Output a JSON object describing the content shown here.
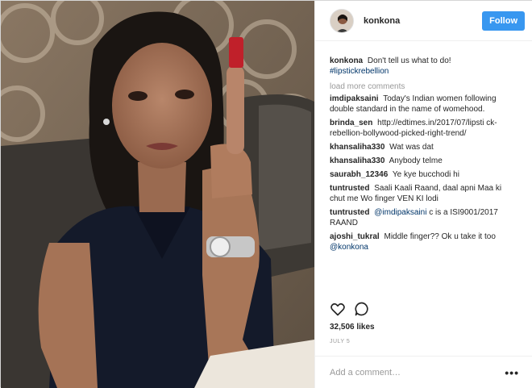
{
  "post": {
    "username": "konkona",
    "follow_label": "Follow",
    "caption": {
      "user": "konkona",
      "text": "Don't tell us what to do!",
      "hashtag": "#lipstickrebellion"
    },
    "load_more_label": "load more comments",
    "comments": [
      {
        "user": "imdipaksaini",
        "text": "Today's Indian women following double standard in the name of womehood.",
        "mention": ""
      },
      {
        "user": "brinda_sen",
        "text": "http://edtimes.in/2017/07/lipsti ck-rebellion-bollywood-picked-right-trend/",
        "mention": ""
      },
      {
        "user": "khansaliha330",
        "text": "Wat was dat",
        "mention": ""
      },
      {
        "user": "khansaliha330",
        "text": "Anybody telme",
        "mention": ""
      },
      {
        "user": "saurabh_12346",
        "text": "Ye kye bucchodi hi",
        "mention": ""
      },
      {
        "user": "tuntrusted",
        "text": "Saali Kaali Raand, daal apni Maa ki chut me Wo finger VEN KI lodi",
        "mention": ""
      },
      {
        "user": "tuntrusted",
        "mention": "@imdipaksaini",
        "text": "c is a ISI9001/2017 RAAND"
      },
      {
        "user": "ajoshi_tukral",
        "text": "Middle finger?? Ok u take it too",
        "mention": "@konkona"
      }
    ],
    "likes": "32,506 likes",
    "date": "JULY 5",
    "add_comment_placeholder": "Add a comment…",
    "more_options": "•••"
  },
  "icons": {
    "like": "heart-icon",
    "comment": "comment-bubble-icon",
    "more": "more-options-icon"
  },
  "colors": {
    "follow_button": "#3897f0",
    "hashtag": "#003569",
    "muted": "#999999"
  }
}
